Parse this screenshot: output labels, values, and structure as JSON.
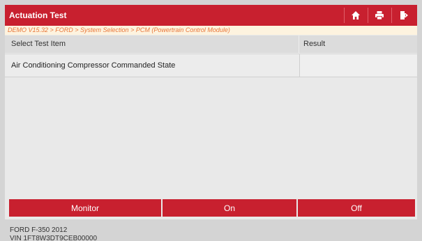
{
  "header": {
    "title": "Actuation Test",
    "icons": [
      "home-icon",
      "print-icon",
      "exit-icon"
    ]
  },
  "breadcrumb": "DEMO V15.32 > FORD > System Selection > PCM (Powertrain Control Module)",
  "table": {
    "columns": [
      "Select Test Item",
      "Result"
    ],
    "rows": [
      {
        "item": "Air Conditioning Compressor Commanded State",
        "result": ""
      }
    ]
  },
  "actions": {
    "monitor": "Monitor",
    "on": "On",
    "off": "Off"
  },
  "vehicle": {
    "model": "FORD F-350 2012",
    "vin": "VIN 1FT8W3DT9CEB00000"
  },
  "colors": {
    "accent": "#c8202f",
    "breadcrumb_text": "#e8763a",
    "breadcrumb_bg": "#fdf3df"
  }
}
